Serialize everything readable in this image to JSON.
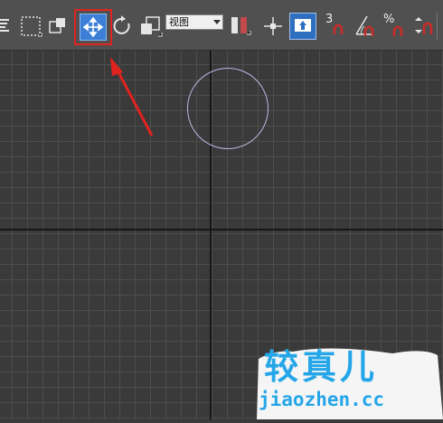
{
  "toolbar": {
    "view_select": {
      "selected": "视图",
      "options": [
        "视图"
      ]
    },
    "angle_snap_label": "3",
    "percent_snap_label": "%",
    "accent_color": "#3d7fd6",
    "highlight_color": "#e0231f"
  },
  "viewport": {
    "grid_color": "#4d4d4d",
    "axis_color": "#151515",
    "circle_color": "#b8b8e6"
  },
  "watermark": {
    "title": "较真儿",
    "url": "jiaozhen.cc",
    "color": "#25a6e8"
  },
  "icons": [
    "select-object-icon",
    "rect-selection-icon",
    "window-crossing-icon",
    "select-and-move-icon",
    "rotate-icon",
    "scale-icon",
    "mirror-icon",
    "pivot-icon",
    "manipulate-icon",
    "snap-toggle-icon",
    "angle-snap-icon",
    "percent-snap-icon",
    "spinner-snap-icon"
  ]
}
